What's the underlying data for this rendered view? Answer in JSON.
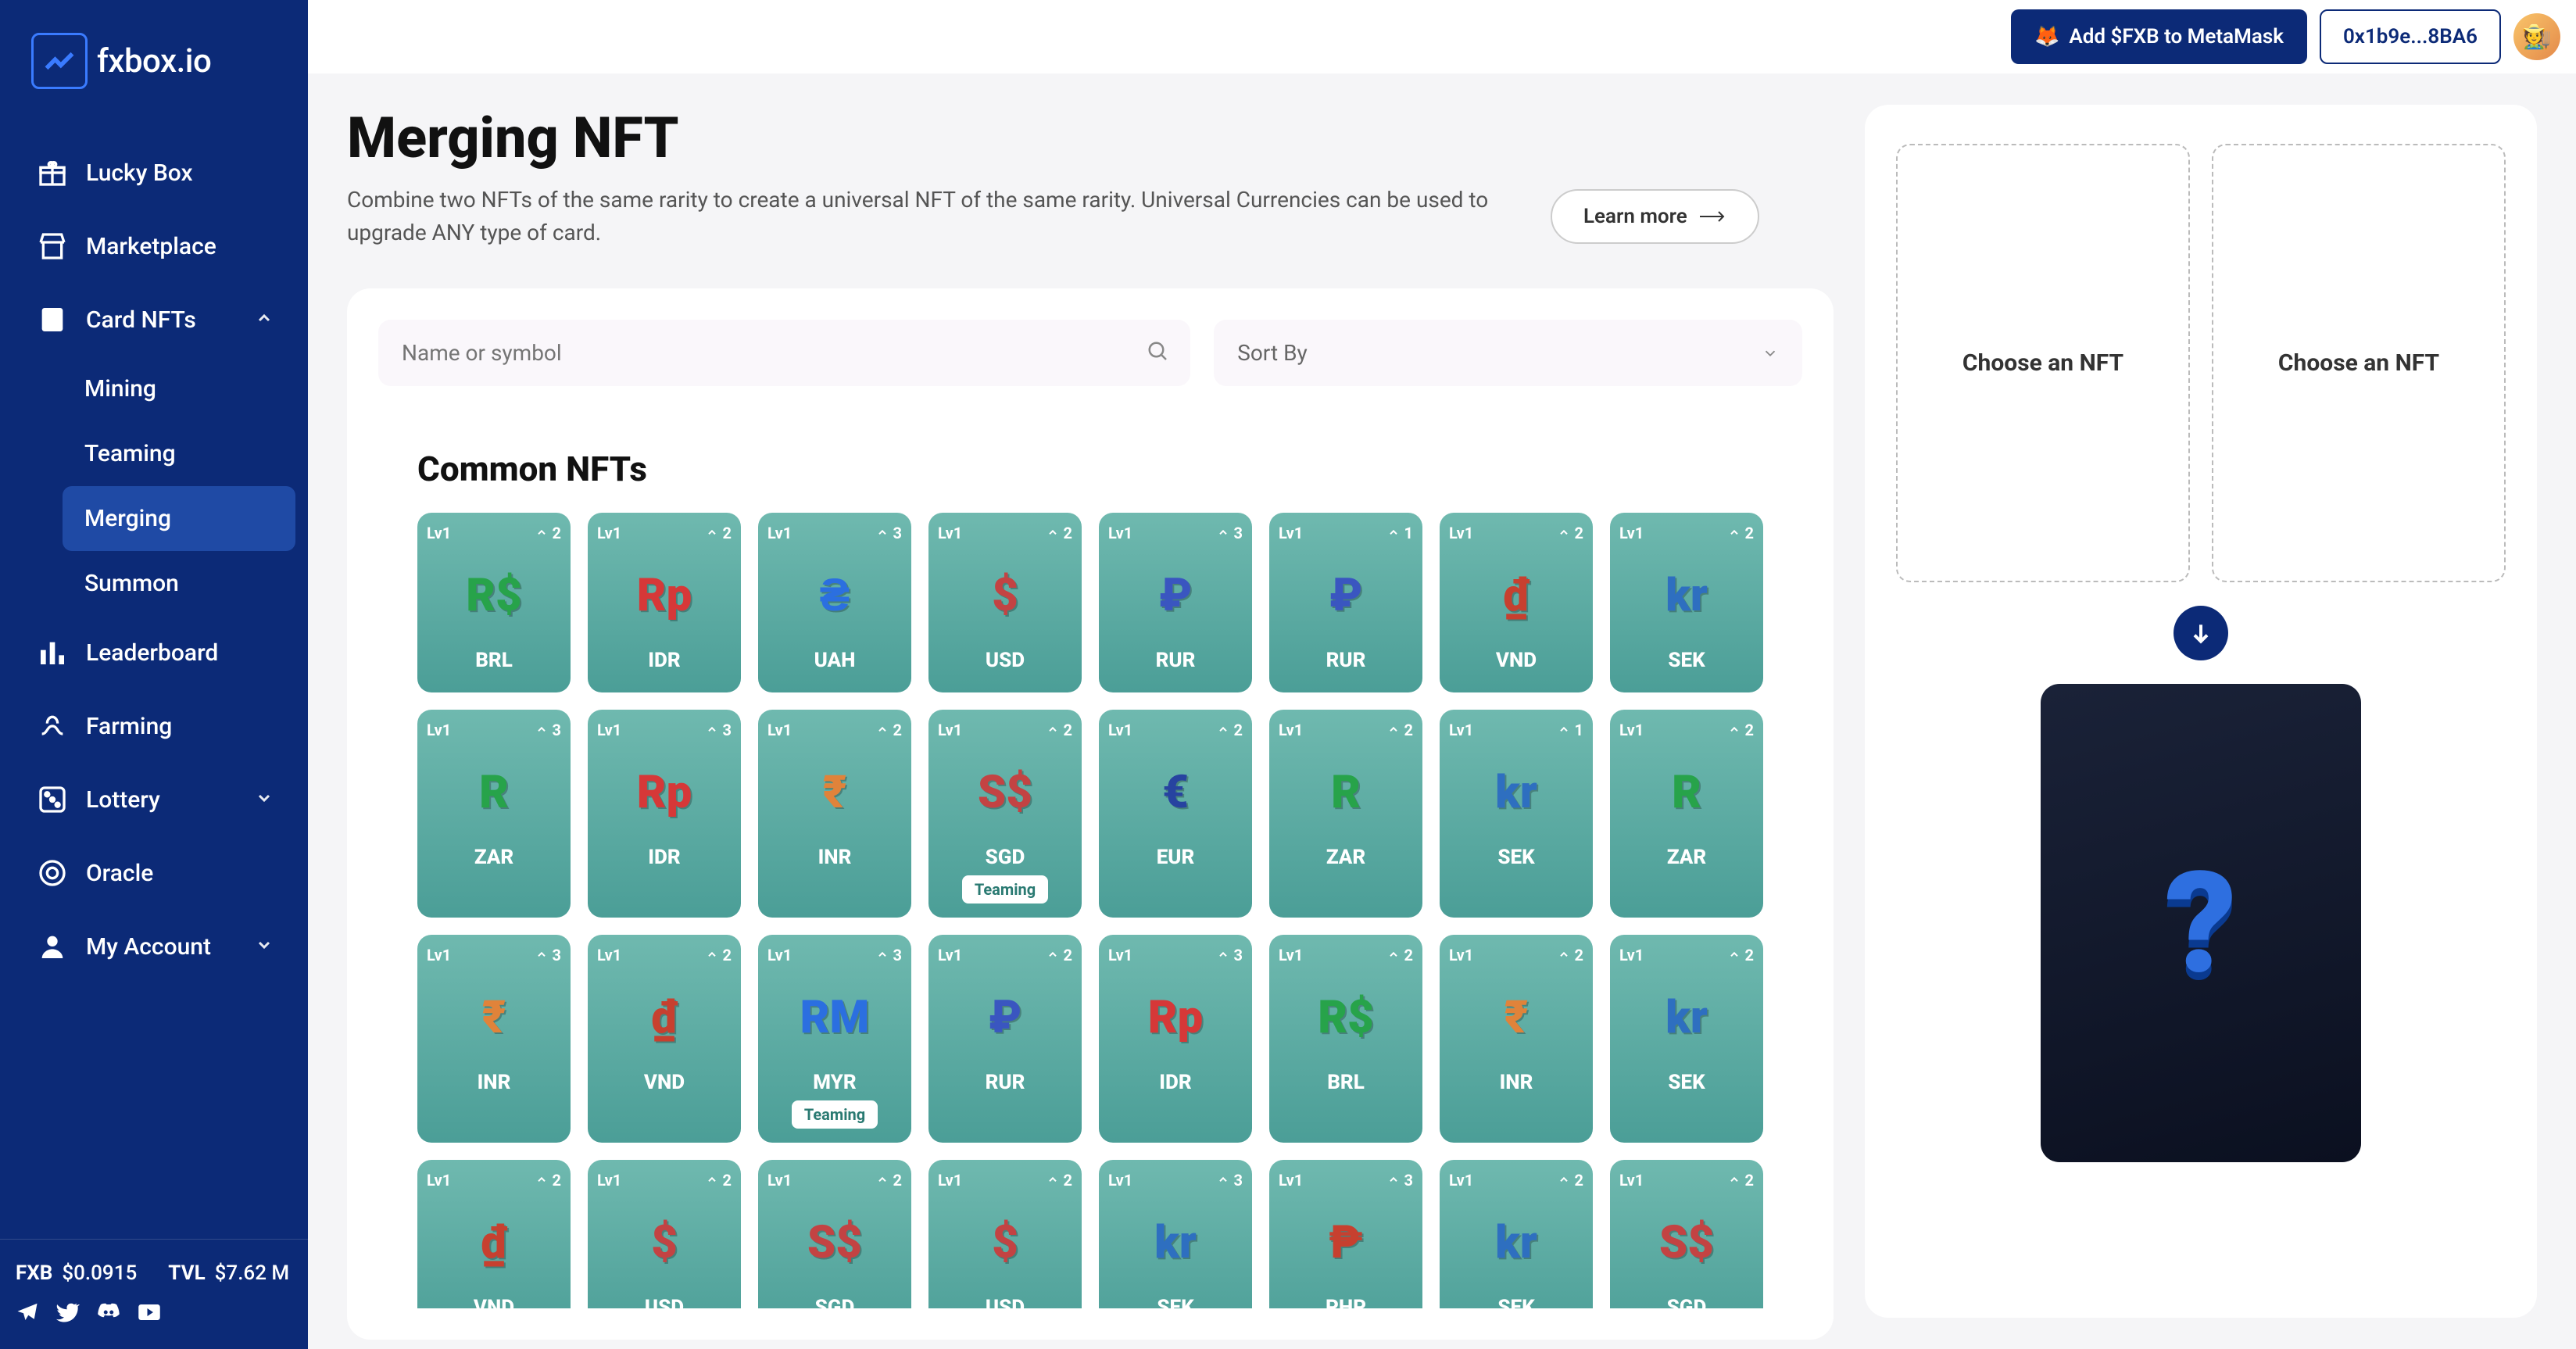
{
  "brand": "fxbox.io",
  "header": {
    "add_btn": "Add $FXB to MetaMask",
    "wallet": "0x1b9e...8BA6"
  },
  "sidebar": {
    "items": [
      {
        "icon": "gift",
        "label": "Lucky Box"
      },
      {
        "icon": "shop",
        "label": "Marketplace"
      },
      {
        "icon": "card",
        "label": "Card NFTs",
        "expanded": true,
        "children": [
          {
            "label": "Mining"
          },
          {
            "label": "Teaming"
          },
          {
            "label": "Merging",
            "active": true
          },
          {
            "label": "Summon"
          }
        ]
      },
      {
        "icon": "chart",
        "label": "Leaderboard"
      },
      {
        "icon": "farm",
        "label": "Farming"
      },
      {
        "icon": "dice",
        "label": "Lottery",
        "chev": true
      },
      {
        "icon": "oracle",
        "label": "Oracle"
      },
      {
        "icon": "user",
        "label": "My Account",
        "chev": true
      }
    ],
    "footer": {
      "fxb_label": "FXB",
      "fxb_val": "$0.0915",
      "tvl_label": "TVL",
      "tvl_val": "$7.62 M"
    }
  },
  "page": {
    "title": "Merging NFT",
    "desc": "Combine two NFTs of the same rarity to create a universal NFT of the same rarity. Universal Currencies can be used to upgrade ANY type of card.",
    "learn_more": "Learn more",
    "search_placeholder": "Name or symbol",
    "sort_label": "Sort By",
    "section": "Common NFTs"
  },
  "merge": {
    "slot_text": "Choose an NFT",
    "result": "?"
  },
  "cards": [
    [
      {
        "lvl": "Lv1",
        "num": "2",
        "sym": "BRL",
        "emoji": "R$",
        "c": "#27a34a"
      },
      {
        "lvl": "Lv1",
        "num": "2",
        "sym": "IDR",
        "emoji": "Rp",
        "c": "#d63838"
      },
      {
        "lvl": "Lv1",
        "num": "3",
        "sym": "UAH",
        "emoji": "₴",
        "c": "#2b6fe0"
      },
      {
        "lvl": "Lv1",
        "num": "2",
        "sym": "USD",
        "emoji": "$",
        "c": "#c34343"
      },
      {
        "lvl": "Lv1",
        "num": "3",
        "sym": "RUR",
        "emoji": "₽",
        "c": "#3a56c0"
      },
      {
        "lvl": "Lv1",
        "num": "1",
        "sym": "RUR",
        "emoji": "₽",
        "c": "#3a56c0"
      },
      {
        "lvl": "Lv1",
        "num": "2",
        "sym": "VND",
        "emoji": "₫",
        "c": "#c7402f"
      },
      {
        "lvl": "Lv1",
        "num": "2",
        "sym": "SEK",
        "emoji": "kr",
        "c": "#2e6fc0"
      }
    ],
    [
      {
        "lvl": "Lv1",
        "num": "3",
        "sym": "ZAR",
        "emoji": "R",
        "c": "#27a34a"
      },
      {
        "lvl": "Lv1",
        "num": "3",
        "sym": "IDR",
        "emoji": "Rp",
        "c": "#d63838"
      },
      {
        "lvl": "Lv1",
        "num": "2",
        "sym": "INR",
        "emoji": "₹",
        "c": "#e0833a"
      },
      {
        "lvl": "Lv1",
        "num": "2",
        "sym": "SGD",
        "emoji": "S$",
        "c": "#c34343",
        "tag": "Teaming"
      },
      {
        "lvl": "Lv1",
        "num": "2",
        "sym": "EUR",
        "emoji": "€",
        "c": "#2743a0"
      },
      {
        "lvl": "Lv1",
        "num": "2",
        "sym": "ZAR",
        "emoji": "R",
        "c": "#27a34a"
      },
      {
        "lvl": "Lv1",
        "num": "1",
        "sym": "SEK",
        "emoji": "kr",
        "c": "#2e6fc0"
      },
      {
        "lvl": "Lv1",
        "num": "2",
        "sym": "ZAR",
        "emoji": "R",
        "c": "#27a34a"
      }
    ],
    [
      {
        "lvl": "Lv1",
        "num": "3",
        "sym": "INR",
        "emoji": "₹",
        "c": "#e0833a"
      },
      {
        "lvl": "Lv1",
        "num": "2",
        "sym": "VND",
        "emoji": "₫",
        "c": "#c7402f"
      },
      {
        "lvl": "Lv1",
        "num": "3",
        "sym": "MYR",
        "emoji": "RM",
        "c": "#2b6fe0",
        "tag": "Teaming"
      },
      {
        "lvl": "Lv1",
        "num": "2",
        "sym": "RUR",
        "emoji": "₽",
        "c": "#3a56c0"
      },
      {
        "lvl": "Lv1",
        "num": "3",
        "sym": "IDR",
        "emoji": "Rp",
        "c": "#d63838"
      },
      {
        "lvl": "Lv1",
        "num": "2",
        "sym": "BRL",
        "emoji": "R$",
        "c": "#27a34a"
      },
      {
        "lvl": "Lv1",
        "num": "2",
        "sym": "INR",
        "emoji": "₹",
        "c": "#e0833a"
      },
      {
        "lvl": "Lv1",
        "num": "2",
        "sym": "SEK",
        "emoji": "kr",
        "c": "#2e6fc0"
      }
    ],
    [
      {
        "lvl": "Lv1",
        "num": "2",
        "sym": "VND",
        "emoji": "₫",
        "c": "#c7402f"
      },
      {
        "lvl": "Lv1",
        "num": "2",
        "sym": "USD",
        "emoji": "$",
        "c": "#c34343"
      },
      {
        "lvl": "Lv1",
        "num": "2",
        "sym": "SGD",
        "emoji": "S$",
        "c": "#c34343"
      },
      {
        "lvl": "Lv1",
        "num": "2",
        "sym": "USD",
        "emoji": "$",
        "c": "#c34343"
      },
      {
        "lvl": "Lv1",
        "num": "3",
        "sym": "SEK",
        "emoji": "kr",
        "c": "#2e6fc0"
      },
      {
        "lvl": "Lv1",
        "num": "3",
        "sym": "PHP",
        "emoji": "₱",
        "c": "#c7402f"
      },
      {
        "lvl": "Lv1",
        "num": "2",
        "sym": "SEK",
        "emoji": "kr",
        "c": "#2e6fc0"
      },
      {
        "lvl": "Lv1",
        "num": "2",
        "sym": "SGD",
        "emoji": "S$",
        "c": "#c34343"
      }
    ]
  ]
}
